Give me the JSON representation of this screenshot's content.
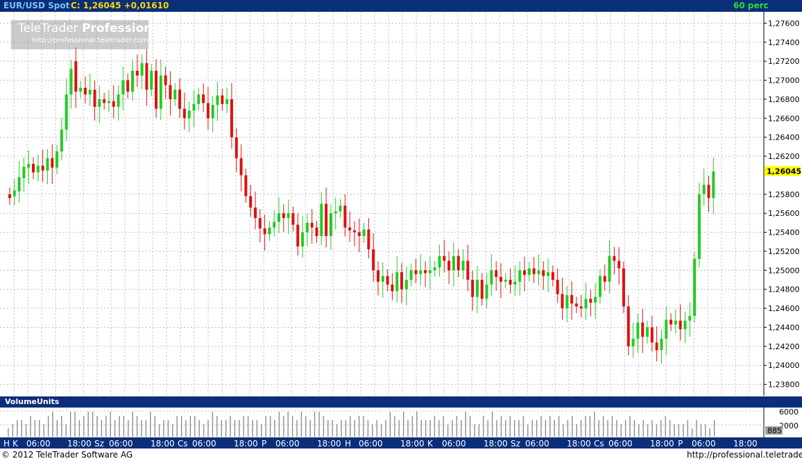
{
  "header": {
    "symbol": "EUR/USD Spot",
    "close_text": "C: 1,26045 +0,01610",
    "period": "60 perc"
  },
  "watermark": {
    "brand_light": "TeleTrader",
    "brand_bold": "Professional",
    "url": "http://professional.teletrader.com/"
  },
  "volume_panel": {
    "title": "VolumeUnits",
    "axis_labels": [
      "6000",
      "2000"
    ],
    "current_value": "885"
  },
  "footer": {
    "copyright": "© 2012 TeleTrader Software AG",
    "url": "http://professional.teletrader.com/"
  },
  "colors": {
    "up": "#22cc22",
    "down": "#dd1111",
    "header_bg": "#0a2e78",
    "price_highlight": "#ffff00"
  },
  "chart_data": {
    "type": "candlestick",
    "y_axis_ticks": [
      "1,27600",
      "1,27400",
      "1,27200",
      "1,27000",
      "1,26800",
      "1,26600",
      "1,26400",
      "1,26200",
      "1,25800",
      "1,25600",
      "1,25400",
      "1,25200",
      "1,25000",
      "1,24800",
      "1,24600",
      "1,24400",
      "1,24200",
      "1,24000",
      "1,23800"
    ],
    "ylim": [
      1.2368,
      1.2772
    ],
    "current_price": 1.26045,
    "current_price_label": "1,26045",
    "x_axis_labels": [
      "H",
      "K",
      "06:00",
      "18:00",
      "Sz",
      "06:00",
      "18:00",
      "Cs",
      "06:00",
      "18:00",
      "P",
      "06:00",
      "18:00",
      "H",
      "06:00",
      "18:00",
      "K",
      "06:00",
      "18:00",
      "Sz",
      "06:00",
      "18:00",
      "Cs",
      "06:00",
      "18:00",
      "P",
      "06:00",
      "18:00"
    ],
    "candles": [
      {
        "t": 0,
        "o": 1.258,
        "c": 1.2576
      },
      {
        "t": 3.5,
        "o": 1.2578,
        "c": 1.2584
      },
      {
        "t": 7,
        "o": 1.2583,
        "c": 1.2598
      },
      {
        "t": 10.5,
        "o": 1.2597,
        "c": 1.2609
      },
      {
        "t": 14,
        "o": 1.2608,
        "c": 1.2612
      },
      {
        "t": 17.5,
        "o": 1.2612,
        "c": 1.2603
      },
      {
        "t": 21,
        "o": 1.2603,
        "c": 1.261
      },
      {
        "t": 24.5,
        "o": 1.261,
        "c": 1.2605
      },
      {
        "t": 28,
        "o": 1.2605,
        "c": 1.2618
      },
      {
        "t": 31.5,
        "o": 1.2618,
        "c": 1.2608
      },
      {
        "t": 35,
        "o": 1.2608,
        "c": 1.2625
      },
      {
        "t": 38.5,
        "o": 1.2625,
        "c": 1.2648
      },
      {
        "t": 42,
        "o": 1.2648,
        "c": 1.2685
      },
      {
        "t": 45.5,
        "o": 1.2685,
        "c": 1.2712
      },
      {
        "t": 49,
        "o": 1.272,
        "c": 1.2688
      },
      {
        "t": 52.5,
        "o": 1.2688,
        "c": 1.2692
      },
      {
        "t": 56,
        "o": 1.2692,
        "c": 1.2685
      },
      {
        "t": 59.5,
        "o": 1.2685,
        "c": 1.269
      },
      {
        "t": 63,
        "o": 1.269,
        "c": 1.2672
      },
      {
        "t": 66.5,
        "o": 1.2672,
        "c": 1.268
      },
      {
        "t": 70,
        "o": 1.268,
        "c": 1.2676
      },
      {
        "t": 73.5,
        "o": 1.2676,
        "c": 1.2678
      },
      {
        "t": 77,
        "o": 1.2678,
        "c": 1.2672
      },
      {
        "t": 80.5,
        "o": 1.2672,
        "c": 1.2685
      },
      {
        "t": 84,
        "o": 1.2685,
        "c": 1.27
      },
      {
        "t": 87.5,
        "o": 1.27,
        "c": 1.2688
      },
      {
        "t": 91,
        "o": 1.2688,
        "c": 1.271
      },
      {
        "t": 94.5,
        "o": 1.271,
        "c": 1.2705
      },
      {
        "t": 98,
        "o": 1.2705,
        "c": 1.2718
      },
      {
        "t": 101.5,
        "o": 1.2718,
        "c": 1.269
      },
      {
        "t": 105,
        "o": 1.269,
        "c": 1.271
      },
      {
        "t": 108.5,
        "o": 1.271,
        "c": 1.267
      },
      {
        "t": 112,
        "o": 1.267,
        "c": 1.2705
      },
      {
        "t": 115.5,
        "o": 1.2705,
        "c": 1.2695
      },
      {
        "t": 119,
        "o": 1.2695,
        "c": 1.268
      },
      {
        "t": 122.5,
        "o": 1.268,
        "c": 1.269
      },
      {
        "t": 126,
        "o": 1.269,
        "c": 1.267
      },
      {
        "t": 129.5,
        "o": 1.267,
        "c": 1.266
      },
      {
        "t": 133,
        "o": 1.266,
        "c": 1.2668
      },
      {
        "t": 136.5,
        "o": 1.2668,
        "c": 1.2675
      },
      {
        "t": 140,
        "o": 1.2675,
        "c": 1.2685
      },
      {
        "t": 143.5,
        "o": 1.2685,
        "c": 1.2676
      },
      {
        "t": 147,
        "o": 1.2676,
        "c": 1.266
      },
      {
        "t": 150.5,
        "o": 1.266,
        "c": 1.2674
      },
      {
        "t": 154,
        "o": 1.2674,
        "c": 1.2684
      },
      {
        "t": 157.5,
        "o": 1.2684,
        "c": 1.2675
      },
      {
        "t": 161,
        "o": 1.2675,
        "c": 1.268
      },
      {
        "t": 164.5,
        "o": 1.268,
        "c": 1.264
      },
      {
        "t": 168,
        "o": 1.264,
        "c": 1.2618
      },
      {
        "t": 171.5,
        "o": 1.2618,
        "c": 1.26
      },
      {
        "t": 175,
        "o": 1.26,
        "c": 1.2578
      },
      {
        "t": 178.5,
        "o": 1.2578,
        "c": 1.2566
      },
      {
        "t": 182,
        "o": 1.2566,
        "c": 1.2555
      },
      {
        "t": 185.5,
        "o": 1.2555,
        "c": 1.2544
      },
      {
        "t": 189,
        "o": 1.2544,
        "c": 1.2538
      },
      {
        "t": 192.5,
        "o": 1.2538,
        "c": 1.2545
      },
      {
        "t": 196,
        "o": 1.2545,
        "c": 1.2551
      },
      {
        "t": 199.5,
        "o": 1.2551,
        "c": 1.256
      },
      {
        "t": 203,
        "o": 1.256,
        "c": 1.2555
      },
      {
        "t": 206.5,
        "o": 1.2555,
        "c": 1.256
      },
      {
        "t": 210,
        "o": 1.256,
        "c": 1.2548
      },
      {
        "t": 213.5,
        "o": 1.2548,
        "c": 1.2525
      },
      {
        "t": 217,
        "o": 1.2525,
        "c": 1.254
      },
      {
        "t": 220.5,
        "o": 1.254,
        "c": 1.255
      },
      {
        "t": 224,
        "o": 1.255,
        "c": 1.2545
      },
      {
        "t": 227.5,
        "o": 1.2545,
        "c": 1.2536
      },
      {
        "t": 231,
        "o": 1.2536,
        "c": 1.257
      },
      {
        "t": 234.5,
        "o": 1.257,
        "c": 1.2536
      },
      {
        "t": 238,
        "o": 1.2536,
        "c": 1.256
      },
      {
        "t": 241.5,
        "o": 1.256,
        "c": 1.2562
      },
      {
        "t": 245,
        "o": 1.2562,
        "c": 1.2568
      },
      {
        "t": 248.5,
        "o": 1.2568,
        "c": 1.2545
      },
      {
        "t": 252,
        "o": 1.2545,
        "c": 1.2542
      },
      {
        "t": 255.5,
        "o": 1.2542,
        "c": 1.254
      },
      {
        "t": 259,
        "o": 1.254,
        "c": 1.2536
      },
      {
        "t": 262.5,
        "o": 1.2536,
        "c": 1.2543
      },
      {
        "t": 266,
        "o": 1.2543,
        "c": 1.2522
      },
      {
        "t": 269.5,
        "o": 1.2522,
        "c": 1.25
      },
      {
        "t": 273,
        "o": 1.25,
        "c": 1.2488
      },
      {
        "t": 276.5,
        "o": 1.2488,
        "c": 1.2494
      },
      {
        "t": 280,
        "o": 1.2494,
        "c": 1.2485
      },
      {
        "t": 283.5,
        "o": 1.2485,
        "c": 1.2478
      },
      {
        "t": 287,
        "o": 1.2478,
        "c": 1.2498
      },
      {
        "t": 290.5,
        "o": 1.2498,
        "c": 1.248
      },
      {
        "t": 294,
        "o": 1.248,
        "c": 1.249
      },
      {
        "t": 297.5,
        "o": 1.249,
        "c": 1.25
      },
      {
        "t": 301,
        "o": 1.25,
        "c": 1.2496
      },
      {
        "t": 304.5,
        "o": 1.2496,
        "c": 1.25
      },
      {
        "t": 308,
        "o": 1.25,
        "c": 1.2497
      },
      {
        "t": 311.5,
        "o": 1.2497,
        "c": 1.25
      },
      {
        "t": 315,
        "o": 1.25,
        "c": 1.2503
      },
      {
        "t": 318.5,
        "o": 1.2503,
        "c": 1.2515
      },
      {
        "t": 322,
        "o": 1.2515,
        "c": 1.251
      },
      {
        "t": 325.5,
        "o": 1.251,
        "c": 1.25
      },
      {
        "t": 329,
        "o": 1.25,
        "c": 1.2515
      },
      {
        "t": 332.5,
        "o": 1.2515,
        "c": 1.25
      },
      {
        "t": 336,
        "o": 1.25,
        "c": 1.251
      },
      {
        "t": 339.5,
        "o": 1.251,
        "c": 1.249
      },
      {
        "t": 343,
        "o": 1.249,
        "c": 1.2472
      },
      {
        "t": 346.5,
        "o": 1.2472,
        "c": 1.249
      },
      {
        "t": 350,
        "o": 1.249,
        "c": 1.247
      },
      {
        "t": 353.5,
        "o": 1.247,
        "c": 1.2485
      },
      {
        "t": 357,
        "o": 1.2485,
        "c": 1.25
      },
      {
        "t": 360.5,
        "o": 1.25,
        "c": 1.2493
      },
      {
        "t": 364,
        "o": 1.2493,
        "c": 1.2488
      },
      {
        "t": 367.5,
        "o": 1.2488,
        "c": 1.249
      },
      {
        "t": 371,
        "o": 1.249,
        "c": 1.2485
      },
      {
        "t": 374.5,
        "o": 1.2485,
        "c": 1.2488
      },
      {
        "t": 378,
        "o": 1.2488,
        "c": 1.25
      },
      {
        "t": 381.5,
        "o": 1.25,
        "c": 1.2495
      },
      {
        "t": 385,
        "o": 1.2495,
        "c": 1.2502
      },
      {
        "t": 388.5,
        "o": 1.2502,
        "c": 1.2496
      },
      {
        "t": 392,
        "o": 1.2496,
        "c": 1.25
      },
      {
        "t": 395.5,
        "o": 1.25,
        "c": 1.2494
      },
      {
        "t": 399,
        "o": 1.2494,
        "c": 1.2498
      },
      {
        "t": 402.5,
        "o": 1.2498,
        "c": 1.249
      },
      {
        "t": 406,
        "o": 1.249,
        "c": 1.2475
      },
      {
        "t": 409.5,
        "o": 1.2475,
        "c": 1.246
      },
      {
        "t": 413,
        "o": 1.246,
        "c": 1.2474
      },
      {
        "t": 416.5,
        "o": 1.2474,
        "c": 1.2465
      },
      {
        "t": 420,
        "o": 1.2465,
        "c": 1.2462
      },
      {
        "t": 423.5,
        "o": 1.2462,
        "c": 1.246
      },
      {
        "t": 427,
        "o": 1.246,
        "c": 1.247
      },
      {
        "t": 430.5,
        "o": 1.247,
        "c": 1.2466
      },
      {
        "t": 434,
        "o": 1.2466,
        "c": 1.2472
      },
      {
        "t": 437.5,
        "o": 1.2472,
        "c": 1.2494
      },
      {
        "t": 441,
        "o": 1.2494,
        "c": 1.2488
      },
      {
        "t": 444.5,
        "o": 1.2488,
        "c": 1.2515
      },
      {
        "t": 448,
        "o": 1.2515,
        "c": 1.251
      },
      {
        "t": 451.5,
        "o": 1.251,
        "c": 1.2502
      },
      {
        "t": 455,
        "o": 1.2502,
        "c": 1.2462
      },
      {
        "t": 458.5,
        "o": 1.2462,
        "c": 1.242
      },
      {
        "t": 462,
        "o": 1.242,
        "c": 1.2428
      },
      {
        "t": 465.5,
        "o": 1.2428,
        "c": 1.2445
      },
      {
        "t": 469,
        "o": 1.2445,
        "c": 1.243
      },
      {
        "t": 472.5,
        "o": 1.243,
        "c": 1.244
      },
      {
        "t": 476,
        "o": 1.244,
        "c": 1.2424
      },
      {
        "t": 479.5,
        "o": 1.2424,
        "c": 1.2416
      },
      {
        "t": 483,
        "o": 1.2416,
        "c": 1.2428
      },
      {
        "t": 486.5,
        "o": 1.2428,
        "c": 1.2448
      },
      {
        "t": 490,
        "o": 1.2448,
        "c": 1.2443
      },
      {
        "t": 493.5,
        "o": 1.2443,
        "c": 1.2447
      },
      {
        "t": 497,
        "o": 1.2447,
        "c": 1.2438
      },
      {
        "t": 500.5,
        "o": 1.2438,
        "c": 1.2447
      },
      {
        "t": 504,
        "o": 1.2447,
        "c": 1.2452
      },
      {
        "t": 507.5,
        "o": 1.2452,
        "c": 1.2512
      },
      {
        "t": 511,
        "o": 1.2512,
        "c": 1.258
      },
      {
        "t": 514.5,
        "o": 1.258,
        "c": 1.259
      },
      {
        "t": 518,
        "o": 1.259,
        "c": 1.2576
      },
      {
        "t": 521.5,
        "o": 1.2576,
        "c": 1.2604
      }
    ],
    "volume_bars": [
      2,
      3,
      4,
      4,
      3,
      5,
      4,
      4,
      3,
      5,
      6,
      4,
      5,
      3,
      6,
      6,
      4,
      5,
      6,
      6,
      5,
      4,
      5,
      6,
      4,
      5,
      5,
      4,
      6,
      5,
      4,
      4,
      6,
      5,
      3,
      4,
      4,
      3,
      5,
      5,
      4,
      5,
      5,
      4,
      3,
      4,
      6,
      5,
      4,
      4,
      5,
      4,
      4,
      5,
      5,
      4,
      4,
      3,
      5,
      5,
      4,
      6,
      5,
      6,
      5,
      4,
      6,
      5,
      4,
      6,
      6,
      5,
      4,
      4,
      3,
      4,
      4,
      5,
      4,
      5,
      5,
      4,
      3,
      4,
      3,
      4,
      6,
      5,
      4,
      6,
      4,
      5,
      6,
      4,
      4,
      4,
      5,
      4,
      5,
      3,
      4,
      5,
      4,
      6,
      5,
      3,
      3,
      5,
      4,
      6,
      4,
      5,
      4,
      5,
      4,
      4,
      5,
      3,
      4,
      4,
      5,
      4,
      5,
      4,
      5,
      3,
      4,
      5,
      3,
      4,
      5,
      5,
      6,
      4,
      5,
      4,
      5,
      4,
      3,
      4,
      5,
      4,
      3,
      4,
      3,
      4,
      3,
      4,
      5,
      4,
      3,
      3,
      3,
      4,
      2,
      4,
      3,
      3,
      2,
      4
    ]
  }
}
